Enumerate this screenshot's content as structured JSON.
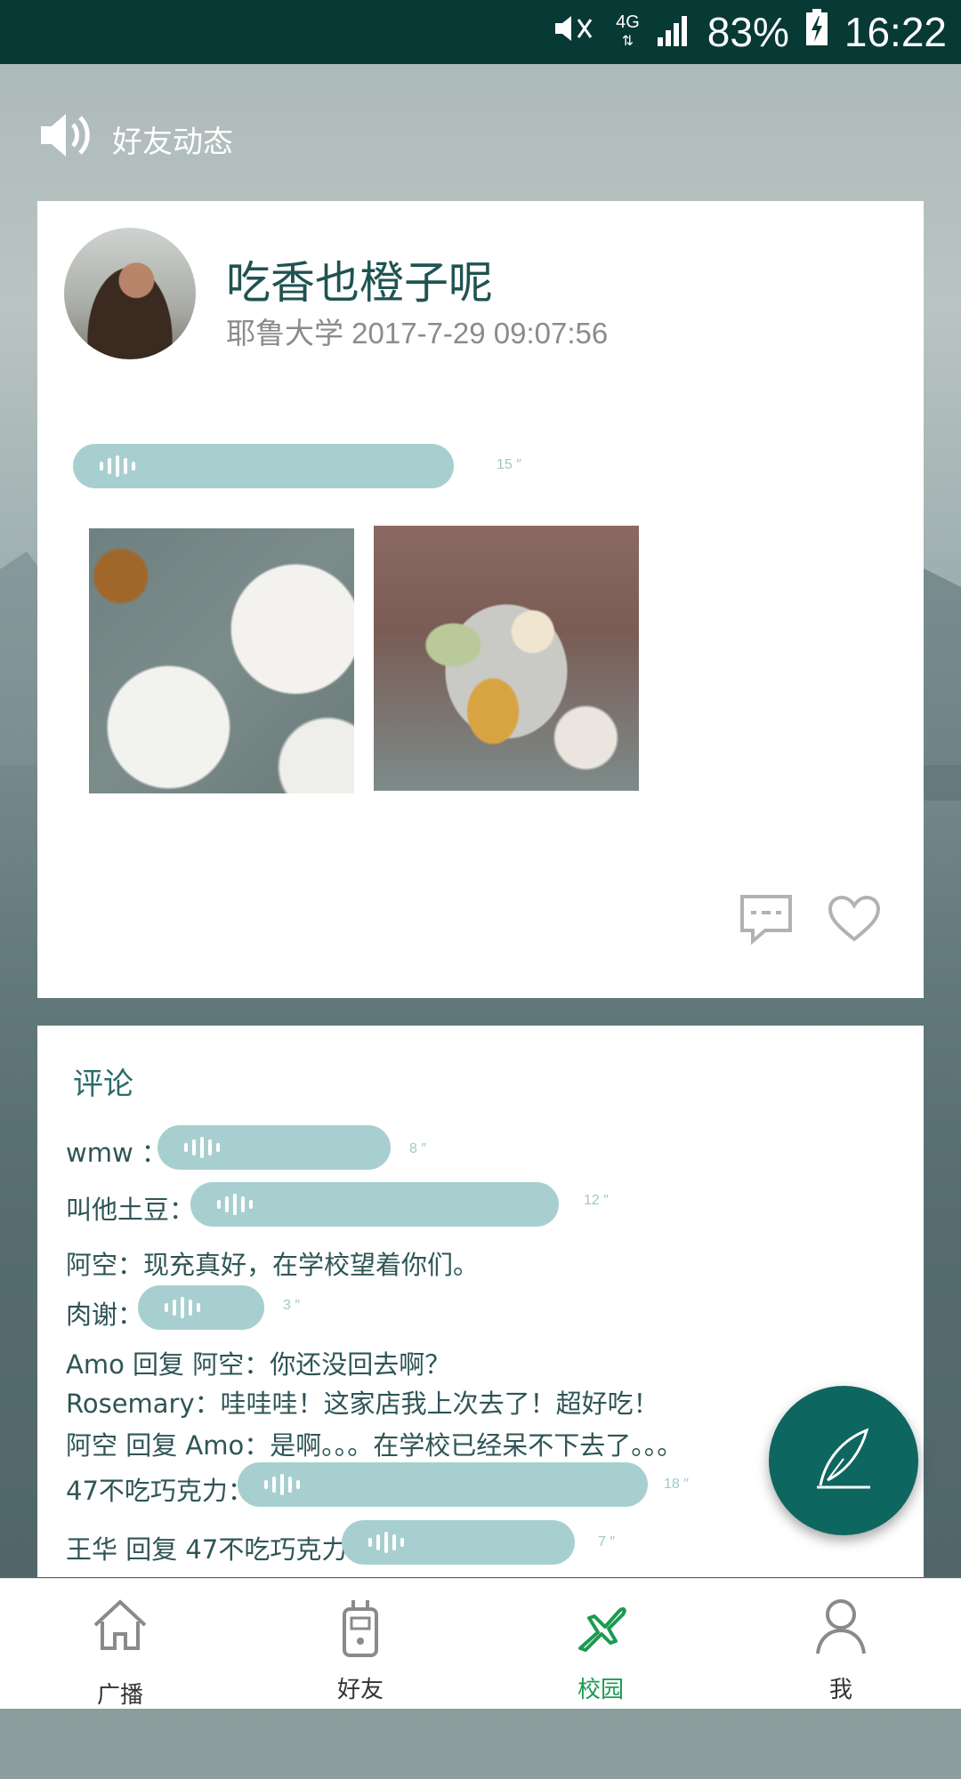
{
  "status_bar": {
    "battery": "83%",
    "time": "16:22",
    "network": "4G"
  },
  "header": {
    "title": "好友动态"
  },
  "post": {
    "author": "吃香也橙子呢",
    "meta": "耶鲁大学 2017-7-29 09:07:56",
    "voice_duration": "15 ″"
  },
  "comments": {
    "title": "评论",
    "rows": [
      {
        "label": "wmw ：",
        "duration": "8 ″"
      },
      {
        "label": "叫他土豆：",
        "duration": "12 ″"
      },
      {
        "label": "阿空：现充真好，在学校望着你们。"
      },
      {
        "label": "肉谢：",
        "duration": "3 ″"
      },
      {
        "label": "Amo 回复 阿空：你还没回去啊？"
      },
      {
        "label": "Rosemary：哇哇哇！这家店我上次去了！超好吃！"
      },
      {
        "label": "阿空 回复 Amo：是啊。。。在学校已经呆不下去了。。。"
      },
      {
        "label": "47不吃巧克力：",
        "duration": "18 ″"
      },
      {
        "label": "王华 回复 47不吃巧克力：",
        "duration": "7 ″"
      }
    ]
  },
  "nav": {
    "items": [
      {
        "label": "广播",
        "icon": "home-icon"
      },
      {
        "label": "好友",
        "icon": "walkie-talkie-icon"
      },
      {
        "label": "校园",
        "icon": "airplane-icon"
      },
      {
        "label": "我",
        "icon": "person-icon"
      }
    ],
    "active_color": "#1b9a52"
  },
  "colors": {
    "accent": "#0e6660",
    "voice_bar": "#a8cfcf",
    "status_bar": "#073935"
  }
}
